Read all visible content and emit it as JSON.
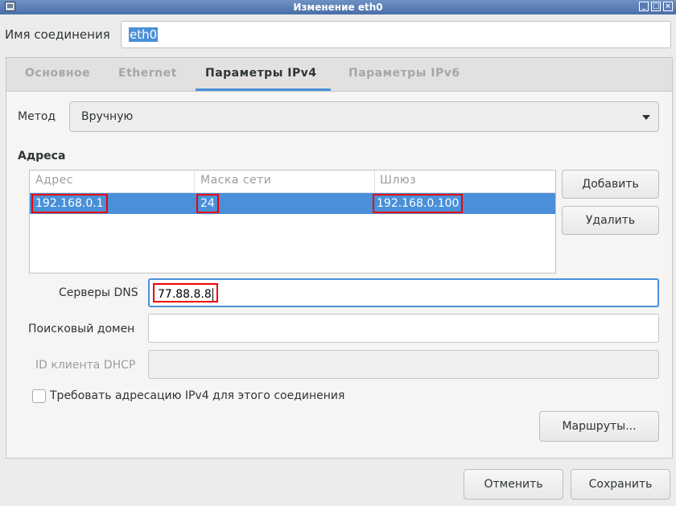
{
  "window": {
    "title": "Изменение eth0"
  },
  "connection_name": {
    "label": "Имя соединения",
    "value": "eth0"
  },
  "tabs": [
    {
      "label": "Основное",
      "active": false
    },
    {
      "label": "Ethernet",
      "active": false
    },
    {
      "label": "Параметры IPv4",
      "active": true
    },
    {
      "label": "Параметры IPv6",
      "active": false
    }
  ],
  "ipv4": {
    "method_label": "Метод",
    "method_value": "Вручную",
    "addresses_heading": "Адреса",
    "columns": [
      "Адрес",
      "Маска сети",
      "Шлюз"
    ],
    "rows": [
      {
        "address": "192.168.0.1",
        "netmask": "24",
        "gateway": "192.168.0.100"
      }
    ],
    "add_button": "Добавить",
    "delete_button": "Удалить",
    "dns_label": "Серверы DNS",
    "dns_value": "77.88.8.8",
    "search_domain_label": "Поисковый домен",
    "search_domain_value": "",
    "dhcp_client_id_label": "ID клиента DHCP",
    "dhcp_client_id_value": "",
    "require_ipv4_label": "Требовать адресацию IPv4 для этого соединения",
    "require_ipv4_checked": false,
    "routes_button": "Маршруты..."
  },
  "footer": {
    "cancel_button": "Отменить",
    "save_button": "Сохранить"
  },
  "colors": {
    "accent": "#4a90d9",
    "highlight_border": "#e00000"
  }
}
